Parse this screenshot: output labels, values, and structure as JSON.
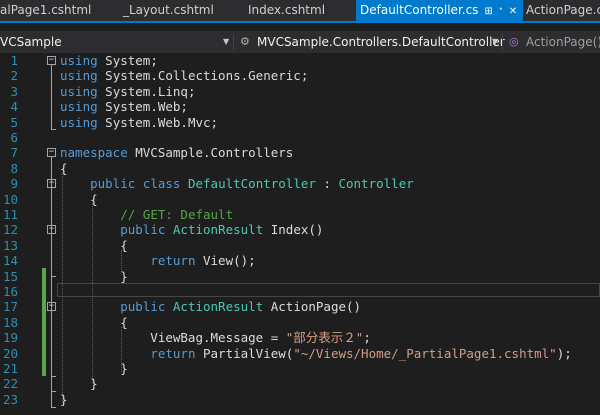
{
  "tabs": [
    {
      "label": "alPage1.cshtml",
      "active": false
    },
    {
      "label": "_Layout.cshtml",
      "active": false
    },
    {
      "label": "Index.cshtml",
      "active": false
    },
    {
      "label": "DefaultController.cs",
      "active": true
    },
    {
      "label": "ActionPage.cs",
      "active": false
    }
  ],
  "tab_icons": {
    "pin": "⊞",
    "unpin": "ᐩ",
    "close": "✕"
  },
  "nav": {
    "project": "VCSample",
    "class": "MVCSample.Controllers.DefaultController",
    "member": "ActionPage()",
    "class_icon": "⚙",
    "member_icon": "◎"
  },
  "colors": {
    "accent": "#007acc",
    "keyword": "#569cd6",
    "type": "#4ec9b0",
    "comment": "#57a64a",
    "string": "#d69d85",
    "line_number": "#2b91af"
  },
  "code_lines": [
    [
      {
        "t": "using",
        "c": "kw"
      },
      {
        "t": " System;"
      }
    ],
    [
      {
        "t": "using",
        "c": "kw"
      },
      {
        "t": " System.Collections.Generic;"
      }
    ],
    [
      {
        "t": "using",
        "c": "kw"
      },
      {
        "t": " System.Linq;"
      }
    ],
    [
      {
        "t": "using",
        "c": "kw"
      },
      {
        "t": " System.Web;"
      }
    ],
    [
      {
        "t": "using",
        "c": "kw"
      },
      {
        "t": " System.Web.Mvc;"
      }
    ],
    [],
    [
      {
        "t": "namespace",
        "c": "kw"
      },
      {
        "t": " MVCSample.Controllers"
      }
    ],
    [
      {
        "t": "{"
      }
    ],
    [
      {
        "t": "    "
      },
      {
        "t": "public",
        "c": "kw"
      },
      {
        "t": " "
      },
      {
        "t": "class",
        "c": "kw"
      },
      {
        "t": " "
      },
      {
        "t": "DefaultController",
        "c": "ty"
      },
      {
        "t": " : "
      },
      {
        "t": "Controller",
        "c": "ty"
      }
    ],
    [
      {
        "t": "    {"
      }
    ],
    [
      {
        "t": "        "
      },
      {
        "t": "// GET: Default",
        "c": "cm"
      }
    ],
    [
      {
        "t": "        "
      },
      {
        "t": "public",
        "c": "kw"
      },
      {
        "t": " "
      },
      {
        "t": "ActionResult",
        "c": "ty"
      },
      {
        "t": " Index()"
      }
    ],
    [
      {
        "t": "        {"
      }
    ],
    [
      {
        "t": "            "
      },
      {
        "t": "return",
        "c": "kw"
      },
      {
        "t": " View();"
      }
    ],
    [
      {
        "t": "        }"
      }
    ],
    [],
    [
      {
        "t": "        "
      },
      {
        "t": "public",
        "c": "kw"
      },
      {
        "t": " "
      },
      {
        "t": "ActionResult",
        "c": "ty"
      },
      {
        "t": " ActionPage()"
      }
    ],
    [
      {
        "t": "        {"
      }
    ],
    [
      {
        "t": "            ViewBag.Message = "
      },
      {
        "t": "\"部分表示２\"",
        "c": "st"
      },
      {
        "t": ";"
      }
    ],
    [
      {
        "t": "            "
      },
      {
        "t": "return",
        "c": "kw"
      },
      {
        "t": " PartialView("
      },
      {
        "t": "\"~/Views/Home/_PartialPage1.cshtml\"",
        "c": "st"
      },
      {
        "t": ");"
      }
    ],
    [
      {
        "t": "        }"
      }
    ],
    [
      {
        "t": "    }"
      }
    ],
    [
      {
        "t": "}"
      }
    ]
  ]
}
